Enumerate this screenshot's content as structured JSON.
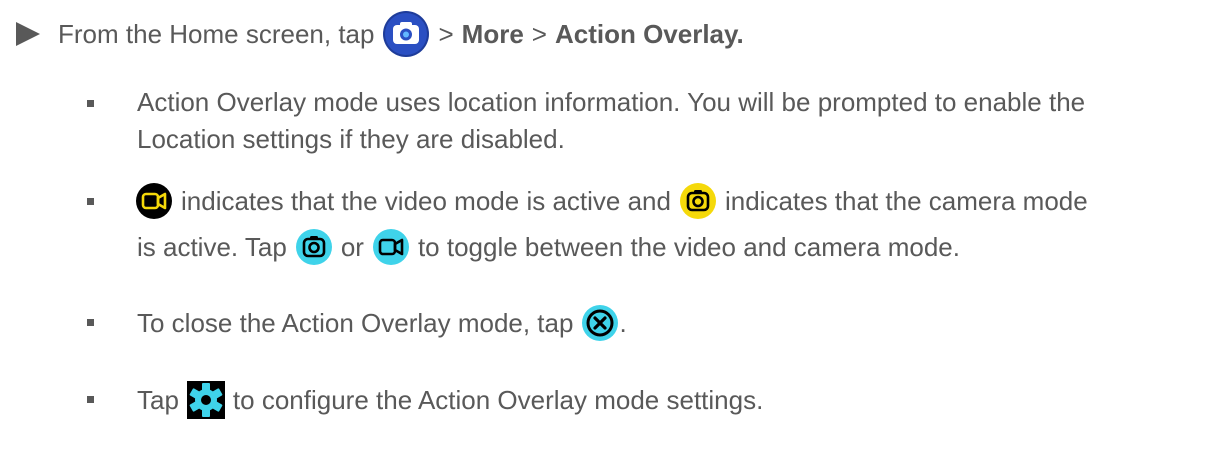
{
  "step": {
    "pre": "From the Home screen, tap",
    "sep1": ">",
    "more": "More",
    "sep2": ">",
    "action": "Action Overlay."
  },
  "bullets": {
    "b1_line1": "Action Overlay mode uses location information. You will be prompted to enable the",
    "b1_line2": "Location settings if they are disabled.",
    "b2_mid": "indicates that the video mode is active and",
    "b2_end": "indicates that the camera mode",
    "b2_l2_pre": "is active. Tap",
    "b2_l2_or": "or",
    "b2_l2_post": "to toggle between the video and camera mode.",
    "b3_pre": "To close the Action Overlay mode, tap",
    "b3_post": ".",
    "b4_pre": "Tap",
    "b4_post": "to configure the Action Overlay mode settings."
  },
  "icons": {
    "camera_app": "camera-app-icon",
    "video_mode": "video-mode-icon",
    "camera_mode": "camera-mode-icon",
    "close": "close-icon",
    "settings": "settings-gear-icon"
  },
  "colors": {
    "text": "#595959",
    "yellow": "#f5d90a",
    "cyan": "#3fd3ea",
    "camera_app_bg": "#1e3c9a"
  }
}
